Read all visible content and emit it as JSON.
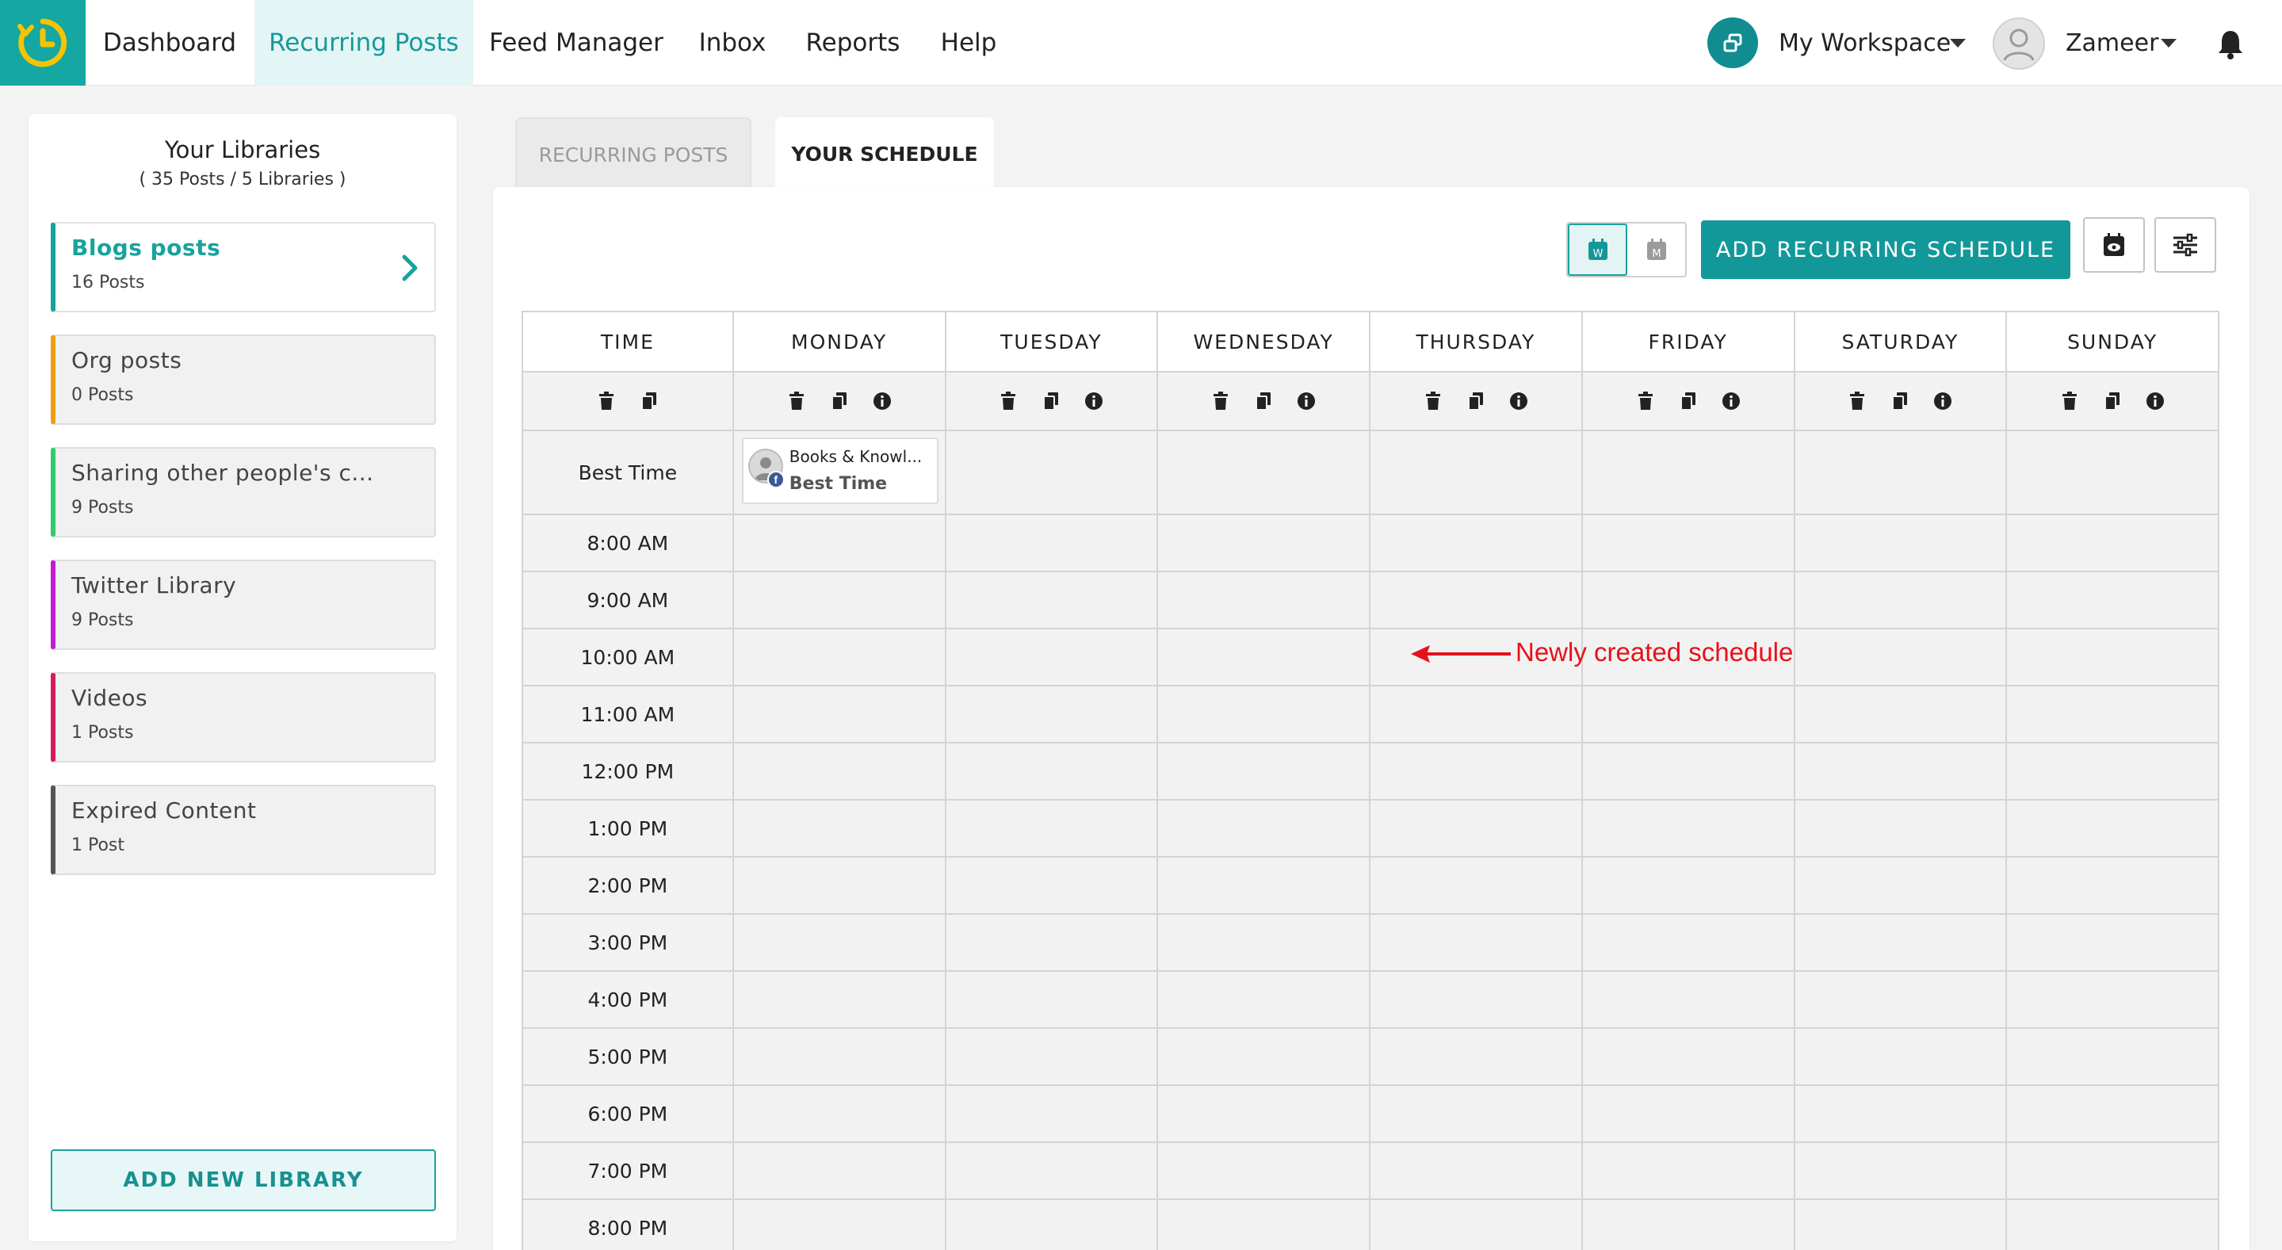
{
  "nav": {
    "items": [
      "Dashboard",
      "Recurring Posts",
      "Feed Manager",
      "Inbox",
      "Reports",
      "Help"
    ],
    "active": "Recurring Posts",
    "workspace": "My Workspace",
    "user": "Zameer"
  },
  "sidebar": {
    "title": "Your Libraries",
    "subtitle": "( 35 Posts / 5 Libraries )",
    "libraries": [
      {
        "name": "Blogs posts",
        "count": "16 Posts",
        "color": "#17a39c",
        "selected": true
      },
      {
        "name": "Org posts",
        "count": "0 Posts",
        "color": "#f39c12"
      },
      {
        "name": "Sharing other people's c...",
        "count": "9 Posts",
        "color": "#2ecc71"
      },
      {
        "name": "Twitter Library",
        "count": "9 Posts",
        "color": "#c41ad6"
      },
      {
        "name": "Videos",
        "count": "1 Posts",
        "color": "#d81b5a"
      },
      {
        "name": "Expired Content",
        "count": "1 Post",
        "color": "#555555"
      }
    ],
    "add_button": "ADD NEW LIBRARY"
  },
  "tabs": {
    "recurring": "RECURRING POSTS",
    "schedule": "YOUR SCHEDULE"
  },
  "toolbar": {
    "week_label": "W",
    "month_label": "M",
    "add_schedule": "ADD RECURRING SCHEDULE"
  },
  "schedule": {
    "time_header": "TIME",
    "days": [
      "MONDAY",
      "TUESDAY",
      "WEDNESDAY",
      "THURSDAY",
      "FRIDAY",
      "SATURDAY",
      "SUNDAY"
    ],
    "best_time_label": "Best Time",
    "times": [
      "8:00 AM",
      "9:00 AM",
      "10:00 AM",
      "11:00 AM",
      "12:00 PM",
      "1:00 PM",
      "2:00 PM",
      "3:00 PM",
      "4:00 PM",
      "5:00 PM",
      "6:00 PM",
      "7:00 PM",
      "8:00 PM"
    ],
    "card": {
      "title": "Books & Knowl...",
      "subtitle": "Best Time",
      "network_badge": "f",
      "day": "MONDAY"
    }
  },
  "annotation": {
    "text": "Newly created schedule",
    "color": "#e8101a"
  },
  "colors": {
    "brand": "#15a7a2",
    "accent": "#13989a"
  }
}
